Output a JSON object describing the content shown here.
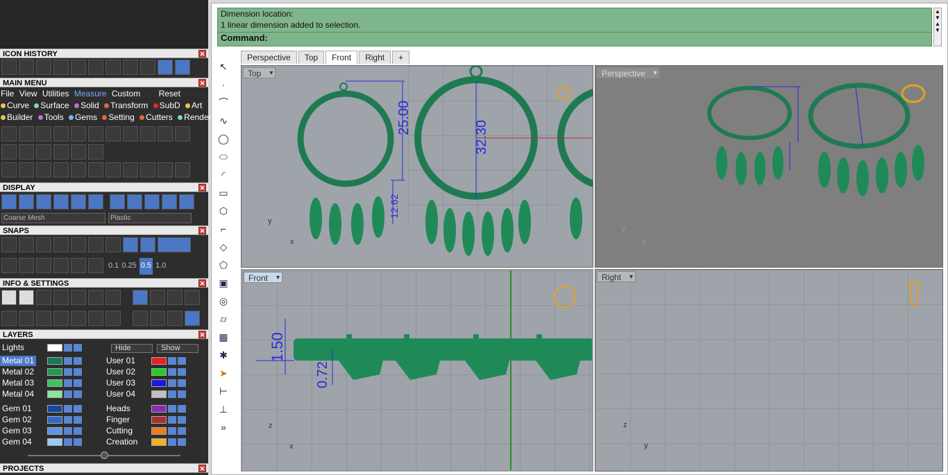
{
  "left_panel": {
    "icon_history": {
      "title": "ICON HISTORY"
    },
    "main_menu": {
      "title": "MAIN MENU",
      "menus": [
        "File",
        "View",
        "Utilities",
        "Measure",
        "Custom"
      ],
      "reset": "Reset",
      "row1": [
        "Curve",
        "Surface",
        "Solid",
        "Transform",
        "SubD",
        "Art"
      ],
      "row2": [
        "Builder",
        "Tools",
        "Gems",
        "Setting",
        "Cutters",
        "Render"
      ]
    },
    "display": {
      "title": "DISPLAY",
      "mesh": "Coarse Mesh",
      "material": "Plastic"
    },
    "snaps": {
      "title": "SNAPS",
      "values": [
        "0.1",
        "0.25",
        "0.5",
        "1.0"
      ]
    },
    "info_settings": {
      "title": "INFO & SETTINGS"
    },
    "layers": {
      "title": "LAYERS",
      "hide": "Hide",
      "show": "Show",
      "lights": "Lights",
      "left": [
        "Metal 01",
        "Metal 02",
        "Metal 03",
        "Metal 04",
        "Gem 01",
        "Gem 02",
        "Gem 03",
        "Gem 04"
      ],
      "right": [
        "User 01",
        "User 02",
        "User 03",
        "User 04",
        "Heads",
        "Finger",
        "Cutting",
        "Creation"
      ],
      "left_colors": [
        "#157a52",
        "#1e9c4e",
        "#3bc45d",
        "#8ae49a",
        "#1546a0",
        "#2d6acb",
        "#5a96e8",
        "#9ccaf5"
      ],
      "right_colors": [
        "#e62020",
        "#20d020",
        "#1818e0",
        "#c0c0c0",
        "#8e2ab0",
        "#a83030",
        "#ec7b19",
        "#f0b020"
      ]
    },
    "projects": {
      "title": "PROJECTS"
    }
  },
  "command": {
    "line1": "Dimension location:",
    "line2": "1 linear dimension added to selection.",
    "prompt": "Command:"
  },
  "tabs": [
    "Perspective",
    "Top",
    "Front",
    "Right"
  ],
  "tab_add": "+",
  "viewports": {
    "top": {
      "label": "Top",
      "dim1": "25.00",
      "dim2": "32.30",
      "dim3": "12.62"
    },
    "perspective": {
      "label": "Perspective"
    },
    "front": {
      "label": "Front",
      "dim1": "1.50",
      "dim2": "0.72"
    },
    "right": {
      "label": "Right"
    }
  },
  "axes": {
    "x": "x",
    "y": "y",
    "z": "z"
  },
  "more_tools": "»"
}
